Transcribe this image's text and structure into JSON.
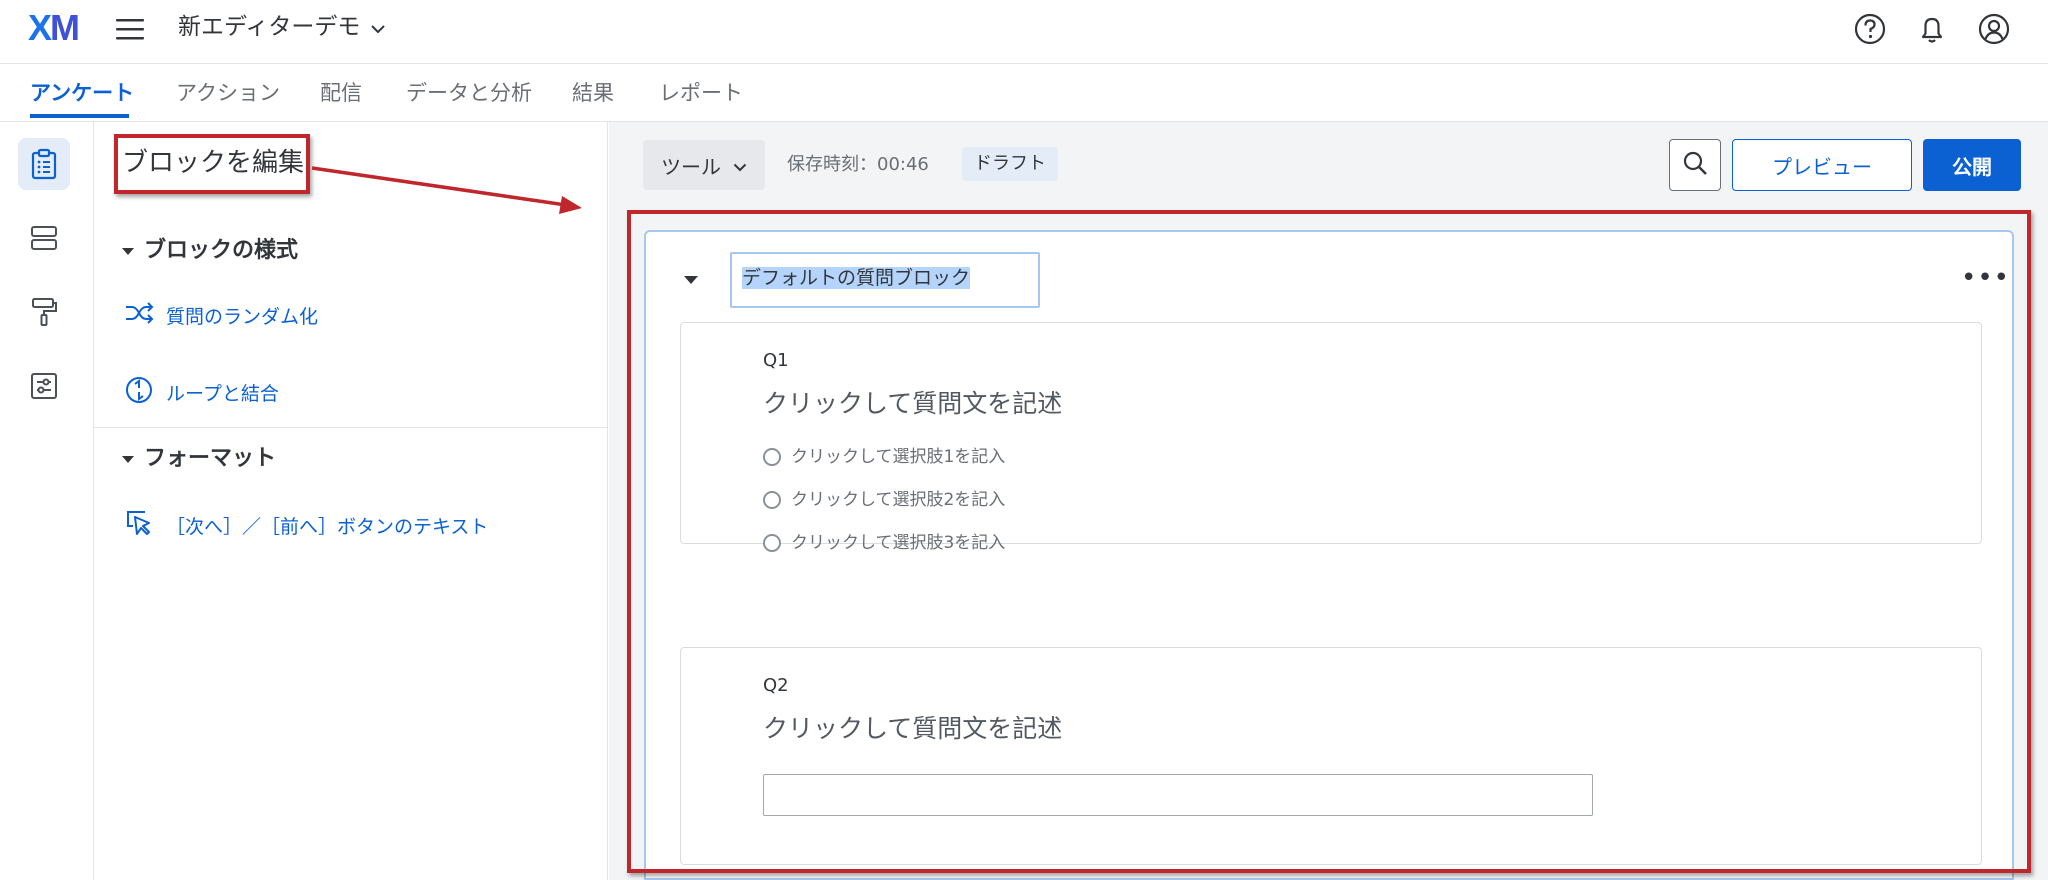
{
  "topbar": {
    "logo_x": "X",
    "logo_m": "M",
    "project_name": "新エディターデモ",
    "icons": [
      "menu-icon",
      "chevron-down-icon",
      "help-icon",
      "bell-icon",
      "user-icon"
    ]
  },
  "tabs": [
    {
      "label": "アンケート",
      "active": true
    },
    {
      "label": "アクション",
      "active": false
    },
    {
      "label": "配信",
      "active": false
    },
    {
      "label": "データと分析",
      "active": false
    },
    {
      "label": "結果",
      "active": false
    },
    {
      "label": "レポート",
      "active": false
    }
  ],
  "rail": {
    "items": [
      "survey-icon",
      "blocks-icon",
      "style-icon",
      "options-icon"
    ],
    "active_index": 0
  },
  "panel": {
    "title": "ブロックを編集",
    "sections": [
      {
        "heading": "ブロックの様式",
        "links": [
          "質問のランダム化",
          "ループと結合"
        ]
      },
      {
        "heading": "フォーマット",
        "links": [
          "［次へ］／［前へ］ボタンのテキスト"
        ]
      }
    ]
  },
  "toolbar": {
    "tools_label": "ツール",
    "saved_text": "保存時刻：00:46",
    "status_badge": "ドラフト",
    "preview_label": "プレビュー",
    "publish_label": "公開"
  },
  "block": {
    "name": "デフォルトの質問ブロック",
    "more_label": "•••",
    "questions": [
      {
        "id": "Q1",
        "text": "クリックして質問文を記述",
        "choices": [
          "クリックして選択肢1を記入",
          "クリックして選択肢2を記入",
          "クリックして選択肢3を記入"
        ]
      },
      {
        "id": "Q2",
        "text": "クリックして質問文を記述",
        "input_value": ""
      }
    ]
  },
  "colors": {
    "accent": "#0b61d1",
    "annotation": "#c0272d",
    "selection": "#b4d4fb"
  }
}
